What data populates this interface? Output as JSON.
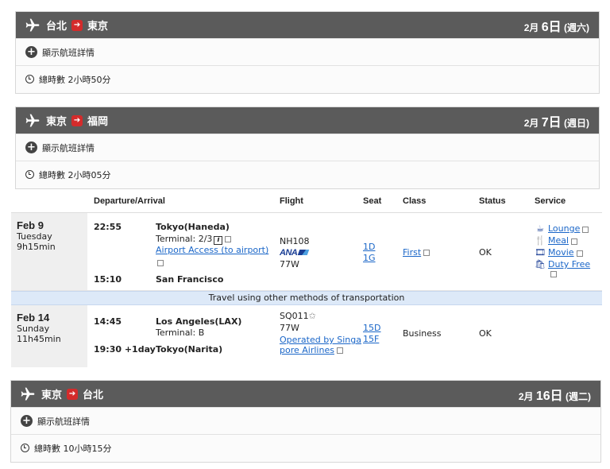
{
  "segments": [
    {
      "from": "台北",
      "to": "東京",
      "date_month": "2月",
      "date_day": "6日",
      "date_weekday": "(週六)",
      "detail_label": "顯示航班詳情",
      "duration": "總時數 2小時50分"
    },
    {
      "from": "東京",
      "to": "福岡",
      "date_month": "2月",
      "date_day": "7日",
      "date_weekday": "(週日)",
      "detail_label": "顯示航班詳情",
      "duration": "總時數 2小時05分"
    },
    {
      "from": "東京",
      "to": "台北",
      "date_month": "2月",
      "date_day": "16日",
      "date_weekday": "(週二)",
      "detail_label": "顯示航班詳情",
      "duration": "總時數 10小時15分"
    }
  ],
  "table": {
    "headers": {
      "dep_arr": "Departure/Arrival",
      "flight": "Flight",
      "seat": "Seat",
      "class": "Class",
      "status": "Status",
      "service": "Service"
    },
    "flights": [
      {
        "date": "Feb 9",
        "weekday": "Tuesday",
        "duration": "9h15min",
        "dep_time": "22:55",
        "dep_place": "Tokyo(Haneda)",
        "terminal": "Terminal: 2/3",
        "access_link": "Airport Access (to airport)",
        "arr_time": "15:10",
        "arr_place": "San Francisco",
        "flight_no": "NH108",
        "airline_logo": "ANA",
        "aircraft": "77W",
        "seats": [
          "1D",
          "1G"
        ],
        "class": "First",
        "status": "OK",
        "services": [
          {
            "icon": "lounge-icon",
            "label": "Lounge"
          },
          {
            "icon": "meal-icon",
            "label": "Meal"
          },
          {
            "icon": "movie-icon",
            "label": "Movie"
          },
          {
            "icon": "duty-free-icon",
            "label": "Duty Free"
          }
        ]
      },
      {
        "date": "Feb 14",
        "weekday": "Sunday",
        "duration": "11h45min",
        "dep_time": "14:45",
        "dep_place": "Los Angeles(LAX)",
        "terminal": "Terminal: B",
        "arr_time": "19:30 +1day",
        "arr_place": "Tokyo(Narita)",
        "flight_no": "SQ011",
        "aircraft": "77W",
        "operated_by": "Operated by Singapore Airlines",
        "operated_line1": "Operated by Singa",
        "operated_line2": "pore Airlines",
        "seats": [
          "15D",
          "15F"
        ],
        "class": "Business",
        "status": "OK"
      }
    ],
    "transport_note": "Travel using other methods of transportation"
  },
  "colors": {
    "header_bg": "#5b5b5b",
    "accent_red": "#d42b2b",
    "link_blue": "#1a66c8",
    "transport_bg": "#dde9f8"
  }
}
